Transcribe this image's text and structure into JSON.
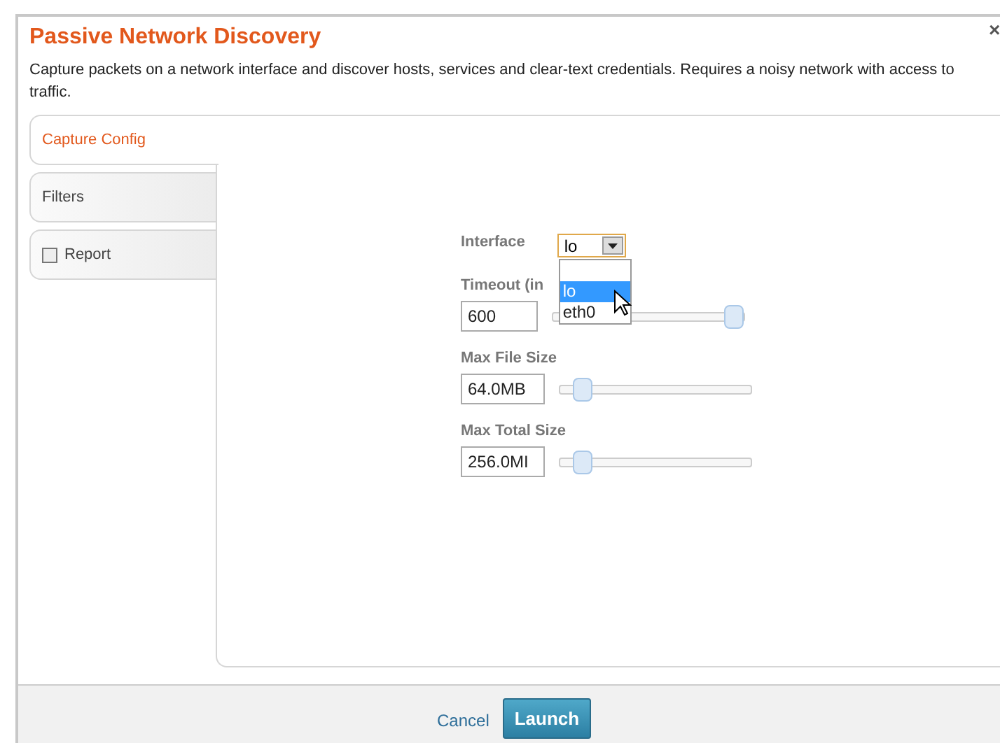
{
  "dialog": {
    "title": "Passive Network Discovery",
    "close": "×",
    "description": "Capture packets on a network interface and discover hosts, services and clear-text credentials. Requires a noisy network with access to traffic."
  },
  "tabs": [
    {
      "label": "Capture Config",
      "selected": true,
      "kind": "plain"
    },
    {
      "label": "Filters",
      "selected": false,
      "kind": "plain"
    },
    {
      "label": "Report",
      "selected": false,
      "kind": "checkbox",
      "checked": false
    }
  ],
  "interface": {
    "label": "Interface",
    "value": "lo",
    "expanded": true,
    "options": [
      {
        "label": "lo",
        "selected": true
      },
      {
        "label": "eth0",
        "selected": false
      }
    ]
  },
  "fields": [
    {
      "label": "Timeout (in",
      "value": "600",
      "level": 1
    },
    {
      "label": "Max File Size",
      "value": "64.0MB",
      "level": 0.07
    },
    {
      "label": "Max Total Size",
      "value": "256.0MI",
      "level": 0.07
    }
  ],
  "footer": {
    "cancel": "Cancel",
    "launch": "Launch"
  }
}
